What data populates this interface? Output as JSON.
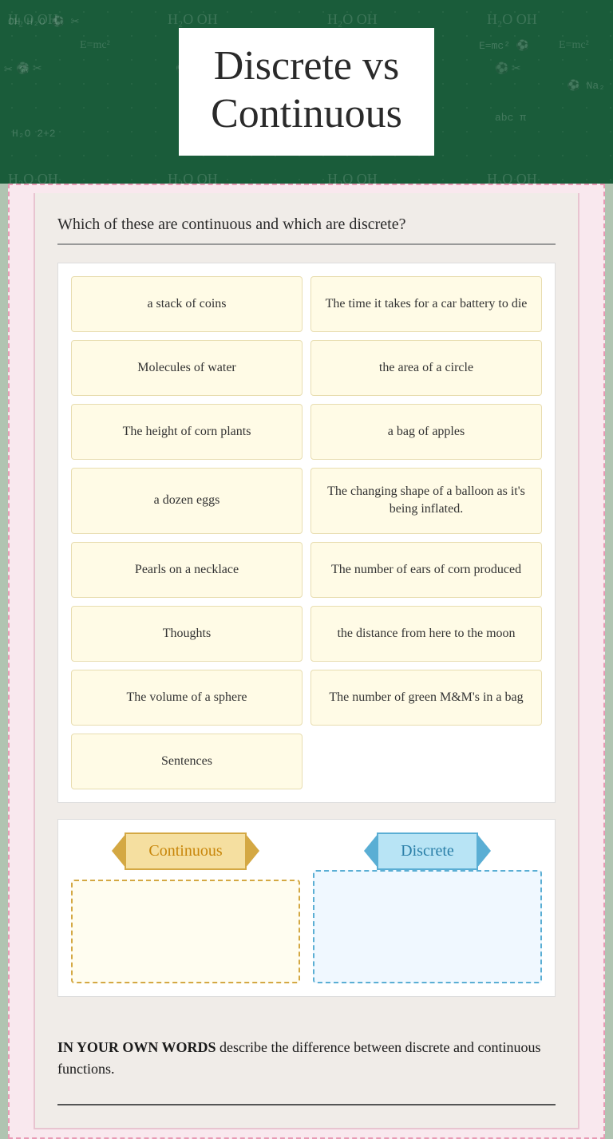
{
  "header": {
    "title_line1": "Discrete vs",
    "title_line2": "Continuous"
  },
  "subtitle": "Which of these are continuous and which are discrete?",
  "items": [
    {
      "id": 1,
      "text": "a stack of coins"
    },
    {
      "id": 2,
      "text": "The time it takes for a car battery to die"
    },
    {
      "id": 3,
      "text": "Molecules of water"
    },
    {
      "id": 4,
      "text": "the area of a circle"
    },
    {
      "id": 5,
      "text": "The height of corn plants"
    },
    {
      "id": 6,
      "text": "a bag of apples"
    },
    {
      "id": 7,
      "text": "a dozen eggs"
    },
    {
      "id": 8,
      "text": "The changing shape of a balloon as it's being inflated."
    },
    {
      "id": 9,
      "text": "Pearls on a necklace"
    },
    {
      "id": 10,
      "text": "The number of ears of corn produced"
    },
    {
      "id": 11,
      "text": "Thoughts"
    },
    {
      "id": 12,
      "text": "the distance from here to the moon"
    },
    {
      "id": 13,
      "text": "The volume of a sphere"
    },
    {
      "id": 14,
      "text": "The number of green M&M's in a bag"
    },
    {
      "id": 15,
      "text": "Sentences"
    }
  ],
  "sort": {
    "continuous_label": "Continuous",
    "discrete_label": "Discrete"
  },
  "description": {
    "prompt_bold": "IN YOUR OWN WORDS",
    "prompt_normal": " describe the difference between discrete and continuous functions."
  }
}
